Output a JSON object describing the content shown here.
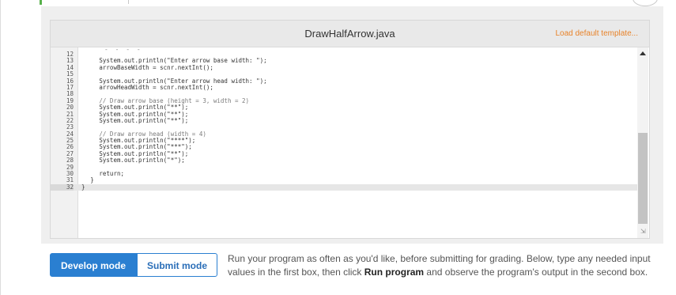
{
  "editor": {
    "filename": "DrawHalfArrow.java",
    "load_template": "Load default template...",
    "partial_top_line": "-  -  -  -",
    "lines": [
      {
        "n": "12",
        "code": ""
      },
      {
        "n": "13",
        "code": "System.out.println(\"Enter arrow base width: \");"
      },
      {
        "n": "14",
        "code": "arrowBaseWidth = scnr.nextInt();"
      },
      {
        "n": "15",
        "code": ""
      },
      {
        "n": "16",
        "code": "System.out.println(\"Enter arrow head width: \");"
      },
      {
        "n": "17",
        "code": "arrowHeadWidth = scnr.nextInt();"
      },
      {
        "n": "18",
        "code": ""
      },
      {
        "n": "19",
        "code": "// Draw arrow base (height = 3, width = 2)"
      },
      {
        "n": "20",
        "code": "System.out.println(\"**\");"
      },
      {
        "n": "21",
        "code": "System.out.println(\"**\");"
      },
      {
        "n": "22",
        "code": "System.out.println(\"**\");"
      },
      {
        "n": "23",
        "code": ""
      },
      {
        "n": "24",
        "code": "// Draw arrow head (width = 4)"
      },
      {
        "n": "25",
        "code": "System.out.println(\"****\");"
      },
      {
        "n": "26",
        "code": "System.out.println(\"***\");"
      },
      {
        "n": "27",
        "code": "System.out.println(\"**\");"
      },
      {
        "n": "28",
        "code": "System.out.println(\"*\");"
      },
      {
        "n": "29",
        "code": ""
      },
      {
        "n": "30",
        "code": "return;"
      },
      {
        "n": "31",
        "code": "}"
      },
      {
        "n": "32",
        "code": "}"
      }
    ]
  },
  "modes": {
    "develop": "Develop mode",
    "submit": "Submit mode"
  },
  "instructions": {
    "part1": "Run your program as often as you'd like, before submitting for grading. Below, type any needed input values in the first box, then click ",
    "bold": "Run program",
    "part2": " and observe the program's output in the second box."
  },
  "colors": {
    "accent_blue": "#2a7fd1",
    "template_orange": "#e8832a",
    "status_green": "#58b14c"
  }
}
